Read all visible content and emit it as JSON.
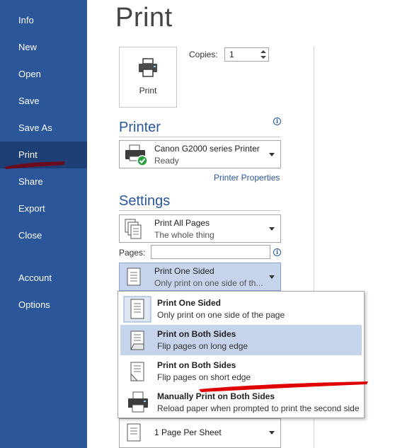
{
  "sidebar": {
    "items": [
      {
        "label": "Info"
      },
      {
        "label": "New"
      },
      {
        "label": "Open"
      },
      {
        "label": "Save"
      },
      {
        "label": "Save As"
      },
      {
        "label": "Print"
      },
      {
        "label": "Share"
      },
      {
        "label": "Export"
      },
      {
        "label": "Close"
      },
      {
        "label": "Account"
      },
      {
        "label": "Options"
      }
    ],
    "active": "Print"
  },
  "page": {
    "title": "Print",
    "print_button_label": "Print",
    "copies_label": "Copies:",
    "copies_value": "1"
  },
  "printer": {
    "heading": "Printer",
    "name": "Canon G2000 series Printer",
    "status": "Ready",
    "properties_link": "Printer Properties"
  },
  "settings": {
    "heading": "Settings",
    "pages_range": {
      "title": "Print All Pages",
      "subtitle": "The whole thing"
    },
    "pages_label": "Pages:",
    "pages_value": "",
    "sides": {
      "title": "Print One Sided",
      "subtitle": "Only print on one side of th..."
    },
    "sides_options": [
      {
        "title": "Print One Sided",
        "subtitle": "Only print on one side of the page"
      },
      {
        "title": "Print on Both Sides",
        "subtitle": "Flip pages on long edge"
      },
      {
        "title": "Print on Both Sides",
        "subtitle": "Flip pages on short edge"
      },
      {
        "title": "Manually Print on Both Sides",
        "subtitle": "Reload paper when prompted to print the second side"
      }
    ],
    "per_sheet": {
      "title": "1 Page Per Sheet"
    }
  },
  "colors": {
    "sidebar_bg": "#2b579a",
    "accent": "#2b579a",
    "highlight": "#c6d4ec",
    "annotation_red": "#e00000"
  }
}
